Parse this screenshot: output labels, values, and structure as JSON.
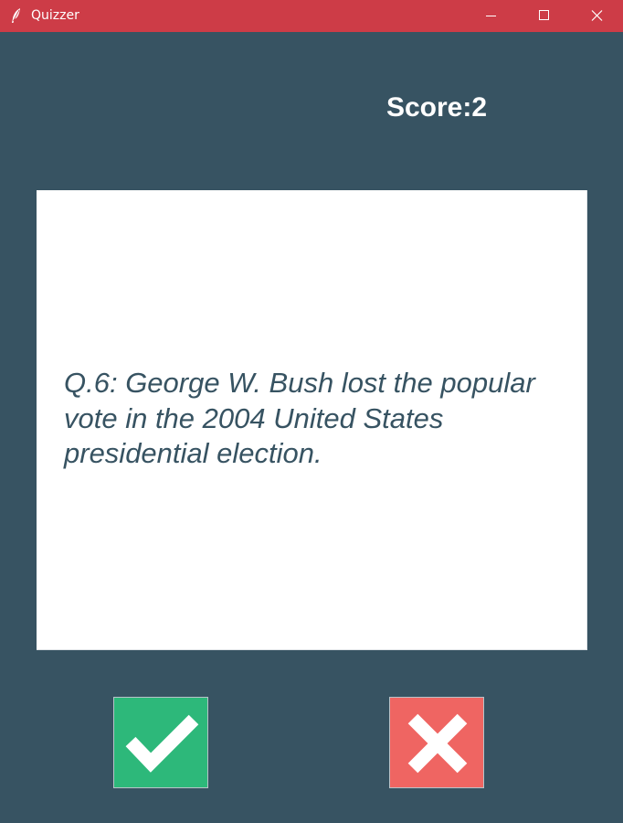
{
  "window": {
    "title": "Quizzer",
    "app_icon": "feather-icon",
    "controls": [
      "minimize-icon",
      "maximize-icon",
      "close-icon"
    ]
  },
  "score": {
    "text": "Score:2"
  },
  "question": {
    "text": "Q.6: George W. Bush lost the popular vote in the 2004 United States presidential election."
  },
  "buttons": {
    "true_icon": "checkmark-icon",
    "false_icon": "cross-icon"
  },
  "colors": {
    "background": "#375362",
    "titlebar": "#cd3c47",
    "card": "#ffffff",
    "question_text": "#375362",
    "true_button": "#2db87a",
    "false_button": "#ef6562"
  }
}
